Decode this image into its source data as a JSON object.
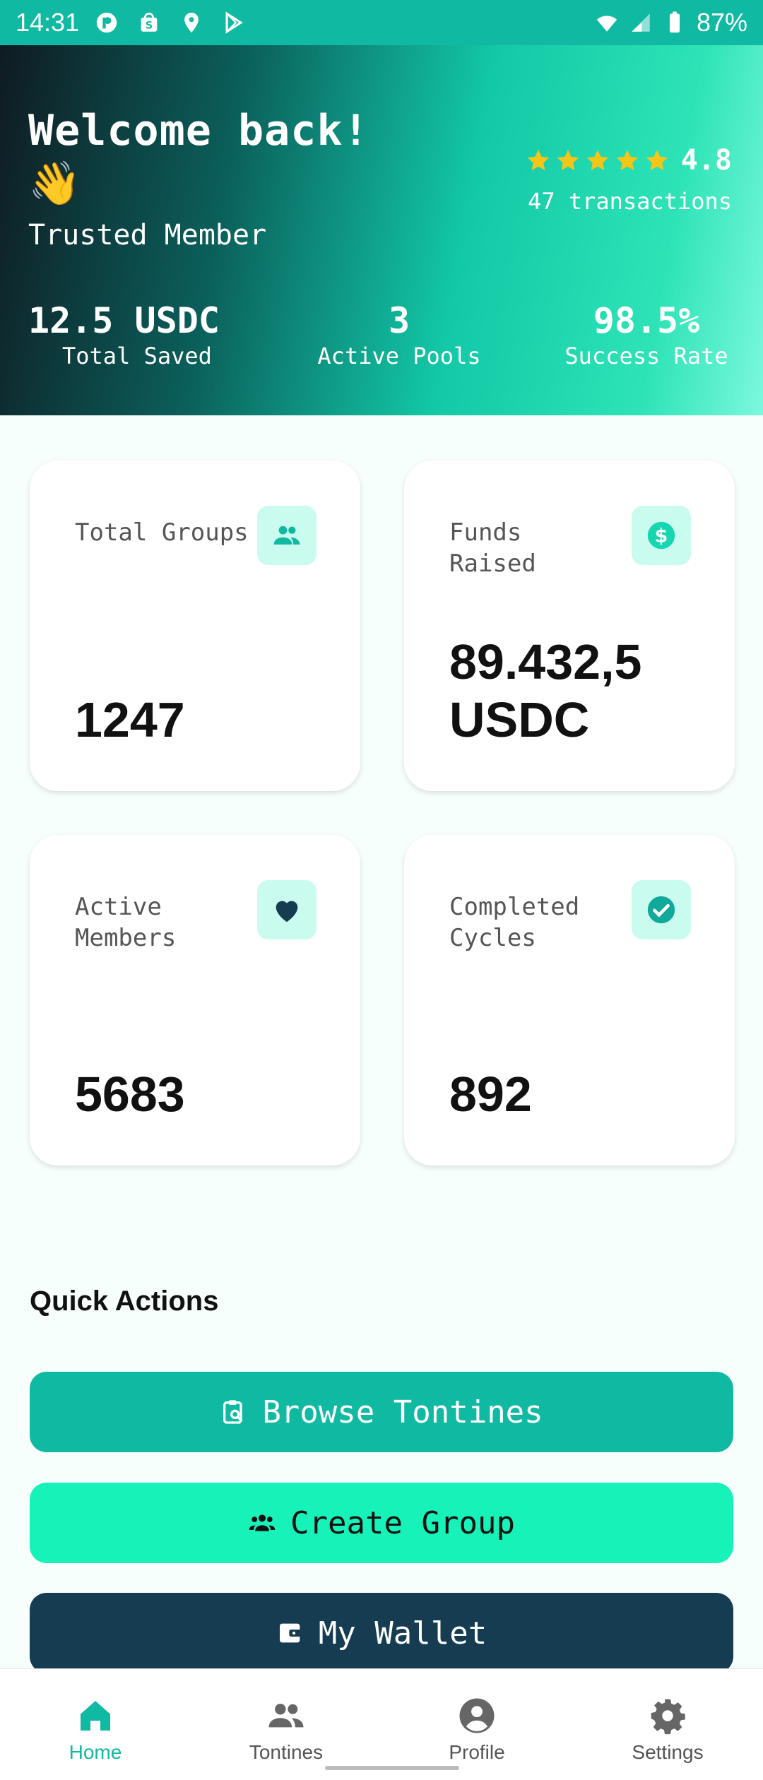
{
  "status_bar": {
    "time": "14:31",
    "battery": "87%"
  },
  "hero": {
    "welcome": "Welcome back!",
    "wave_emoji": "👋",
    "member_status": "Trusted Member",
    "rating_value": "4.8",
    "stars": 5,
    "transactions": "47 transactions",
    "stats": [
      {
        "value": "12.5 USDC",
        "label": "Total Saved"
      },
      {
        "value": "3",
        "label": "Active Pools"
      },
      {
        "value": "98.5%",
        "label": "Success Rate"
      }
    ]
  },
  "cards": [
    {
      "label": "Total Groups",
      "value": "1247",
      "icon": "group-icon"
    },
    {
      "label": "Funds Raised",
      "value": "89.432,5 USDC",
      "icon": "dollar-icon"
    },
    {
      "label": "Active Members",
      "value": "5683",
      "icon": "heart-icon"
    },
    {
      "label": "Completed Cycles",
      "value": "892",
      "icon": "check-circle-icon"
    }
  ],
  "quick_actions": {
    "title": "Quick Actions",
    "buttons": [
      {
        "label": "Browse Tontines",
        "icon": "search-doc-icon"
      },
      {
        "label": "Create Group",
        "icon": "group-icon"
      },
      {
        "label": "My Wallet",
        "icon": "wallet-icon"
      }
    ]
  },
  "bottom_nav": [
    {
      "label": "Home",
      "icon": "home-icon",
      "active": true
    },
    {
      "label": "Tontines",
      "icon": "people-icon",
      "active": false
    },
    {
      "label": "Profile",
      "icon": "profile-icon",
      "active": false
    },
    {
      "label": "Settings",
      "icon": "gear-icon",
      "active": false
    }
  ],
  "colors": {
    "accent": "#10b9a2",
    "accent_light": "#16f2b8",
    "dark_button": "#163c52",
    "star": "#f5c518"
  }
}
